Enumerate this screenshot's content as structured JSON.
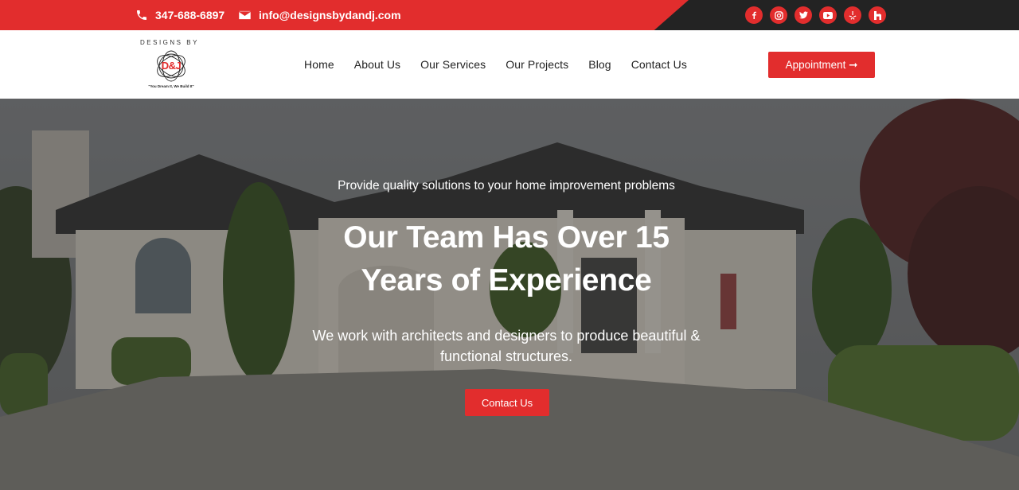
{
  "topbar": {
    "phone": "347-688-6897",
    "email": "info@designsbydandj.com",
    "socials": [
      "facebook-icon",
      "instagram-icon",
      "twitter-icon",
      "youtube-icon",
      "yelp-icon",
      "houzz-icon"
    ]
  },
  "logo": {
    "top_text": "DESIGNS BY",
    "mark": "D&J",
    "tagline": "\"You Dream It, We Build It\""
  },
  "nav": {
    "items": [
      "Home",
      "About Us",
      "Our Services",
      "Our Projects",
      "Blog",
      "Contact Us"
    ]
  },
  "header": {
    "appointment_label": "Appointment ➞"
  },
  "hero": {
    "kicker": "Provide quality solutions to your home improvement problems",
    "headline": "Our Team Has Over 15 Years of Experience",
    "subtext": "We work with architects and designers to produce beautiful & functional structures.",
    "cta": "Contact Us"
  },
  "colors": {
    "brand_red": "#e22d2d",
    "dark": "#232323"
  }
}
